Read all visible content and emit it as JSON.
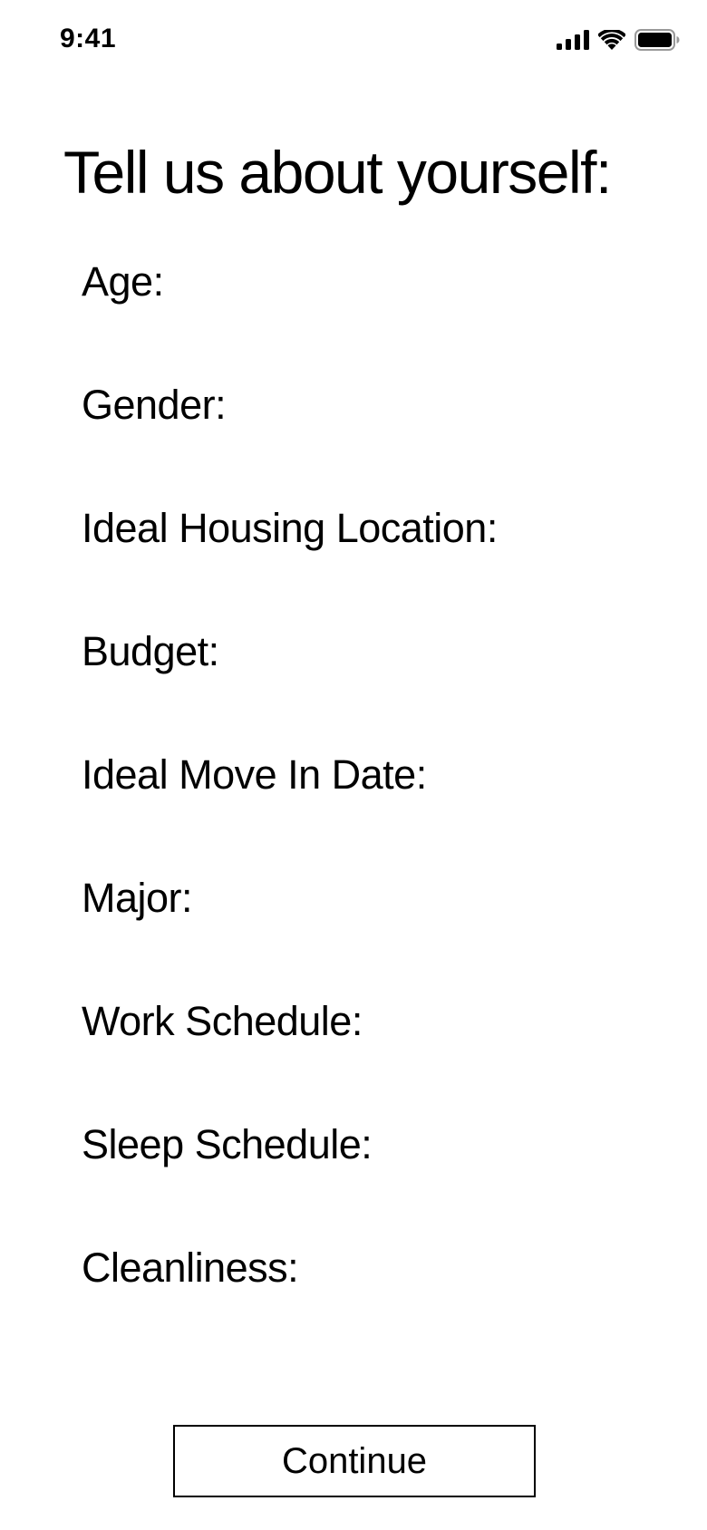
{
  "status_bar": {
    "time": "9:41",
    "icons": [
      "cellular-signal-icon",
      "wifi-icon",
      "battery-icon"
    ]
  },
  "title": "Tell us about yourself:",
  "fields": [
    {
      "label": "Age:"
    },
    {
      "label": "Gender:"
    },
    {
      "label": "Ideal Housing Location:"
    },
    {
      "label": "Budget:"
    },
    {
      "label": "Ideal Move In Date:"
    },
    {
      "label": "Major:"
    },
    {
      "label": "Work Schedule:"
    },
    {
      "label": "Sleep Schedule:"
    },
    {
      "label": "Cleanliness:"
    }
  ],
  "continue_button": {
    "label": "Continue"
  }
}
